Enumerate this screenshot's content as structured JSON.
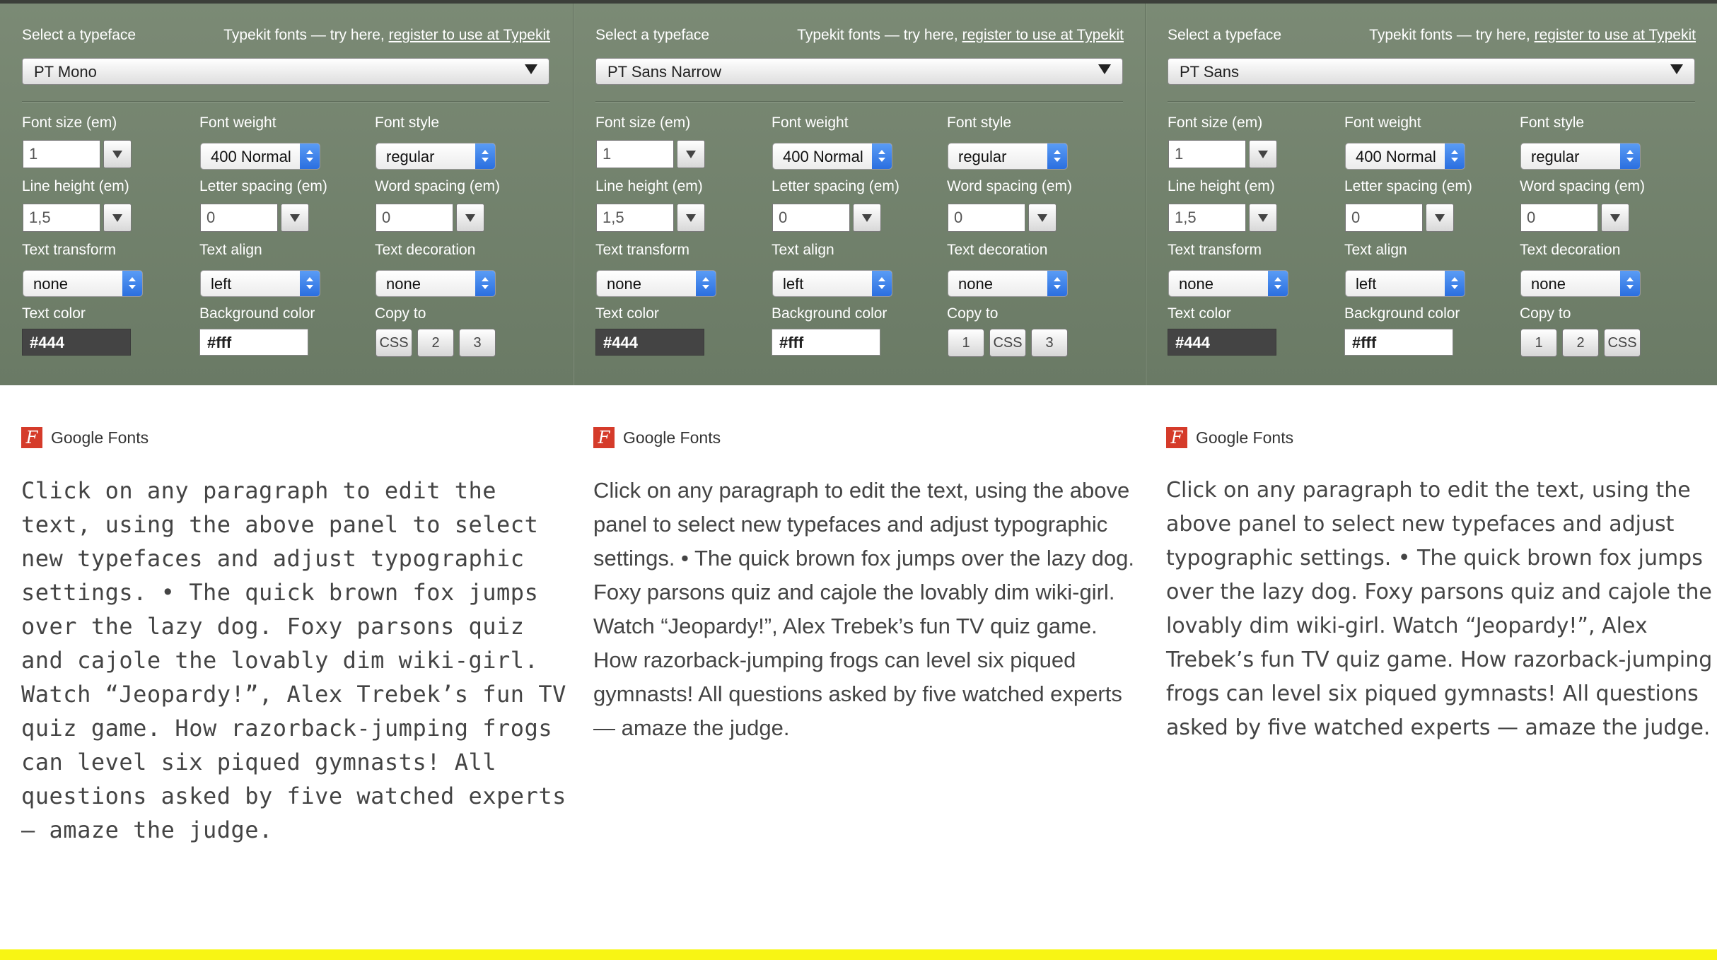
{
  "panels": [
    {
      "typeface_label": "Select a typeface",
      "typekit_prefix": "Typekit fonts — try here, ",
      "typekit_link": "register to use at Typekit",
      "typeface": "PT Mono",
      "font_size_label": "Font size (em)",
      "font_size": "1",
      "font_weight_label": "Font weight",
      "font_weight": "400 Normal",
      "font_style_label": "Font style",
      "font_style": "regular",
      "line_height_label": "Line height (em)",
      "line_height": "1,5",
      "letter_spacing_label": "Letter spacing (em)",
      "letter_spacing": "0",
      "word_spacing_label": "Word spacing (em)",
      "word_spacing": "0",
      "text_transform_label": "Text transform",
      "text_transform": "none",
      "text_align_label": "Text align",
      "text_align": "left",
      "text_decoration_label": "Text decoration",
      "text_decoration": "none",
      "text_color_label": "Text color",
      "text_color": "#444",
      "bg_color_label": "Background color",
      "bg_color": "#fff",
      "copy_label": "Copy to",
      "copy_buttons": [
        "CSS",
        "2",
        "3"
      ]
    },
    {
      "typeface_label": "Select a typeface",
      "typekit_prefix": "Typekit fonts — try here, ",
      "typekit_link": "register to use at Typekit",
      "typeface": "PT Sans Narrow",
      "font_size_label": "Font size (em)",
      "font_size": "1",
      "font_weight_label": "Font weight",
      "font_weight": "400 Normal",
      "font_style_label": "Font style",
      "font_style": "regular",
      "line_height_label": "Line height (em)",
      "line_height": "1,5",
      "letter_spacing_label": "Letter spacing (em)",
      "letter_spacing": "0",
      "word_spacing_label": "Word spacing (em)",
      "word_spacing": "0",
      "text_transform_label": "Text transform",
      "text_transform": "none",
      "text_align_label": "Text align",
      "text_align": "left",
      "text_decoration_label": "Text decoration",
      "text_decoration": "none",
      "text_color_label": "Text color",
      "text_color": "#444",
      "bg_color_label": "Background color",
      "bg_color": "#fff",
      "copy_label": "Copy to",
      "copy_buttons": [
        "1",
        "CSS",
        "3"
      ]
    },
    {
      "typeface_label": "Select a typeface",
      "typekit_prefix": "Typekit fonts — try here, ",
      "typekit_link": "register to use at Typekit",
      "typeface": "PT Sans",
      "font_size_label": "Font size (em)",
      "font_size": "1",
      "font_weight_label": "Font weight",
      "font_weight": "400 Normal",
      "font_style_label": "Font style",
      "font_style": "regular",
      "line_height_label": "Line height (em)",
      "line_height": "1,5",
      "letter_spacing_label": "Letter spacing (em)",
      "letter_spacing": "0",
      "word_spacing_label": "Word spacing (em)",
      "word_spacing": "0",
      "text_transform_label": "Text transform",
      "text_transform": "none",
      "text_align_label": "Text align",
      "text_align": "left",
      "text_decoration_label": "Text decoration",
      "text_decoration": "none",
      "text_color_label": "Text color",
      "text_color": "#444",
      "bg_color_label": "Background color",
      "bg_color": "#fff",
      "copy_label": "Copy to",
      "copy_buttons": [
        "1",
        "2",
        "CSS"
      ]
    }
  ],
  "previews": [
    {
      "source_icon": "google-fonts-icon",
      "source": "Google Fonts",
      "text": "Click on any paragraph to edit the text, using the above panel to select new typefaces and adjust typographic settings. • The quick brown fox jumps over the lazy dog. Foxy parsons quiz and cajole the lovably dim wiki-girl. Watch “Jeopardy!”, Alex Trebek’s fun TV quiz game. How razorback-jumping frogs can level six piqued gymnasts! All questions asked by five watched experts — amaze the judge."
    },
    {
      "source_icon": "google-fonts-icon",
      "source": "Google Fonts",
      "text": "Click on any paragraph to edit the text, using the above panel to select new typefaces and adjust typographic settings. • The quick brown fox jumps over the lazy dog. Foxy parsons quiz and cajole the lovably dim wiki-girl. Watch “Jeopardy!”, Alex Trebek’s fun TV quiz game. How razorback-jumping frogs can level six piqued gymnasts! All questions asked by five watched experts — amaze the judge."
    },
    {
      "source_icon": "google-fonts-icon",
      "source": "Google Fonts",
      "text": "Click on any paragraph to edit the text, using the above panel to select new typefaces and adjust typographic settings. • The quick brown fox jumps over the lazy dog. Foxy parsons quiz and cajole the lovably dim wiki-girl. Watch “Jeopardy!”, Alex Trebek’s fun TV quiz game. How razorback-jumping frogs can level six piqued gymnasts! All questions asked by five watched experts — amaze the judge."
    }
  ],
  "colors": {
    "panel_bg": "#74836e",
    "accent_bar": "#f8f514",
    "text_color": "#444444",
    "icon_red": "#d53b2a"
  }
}
